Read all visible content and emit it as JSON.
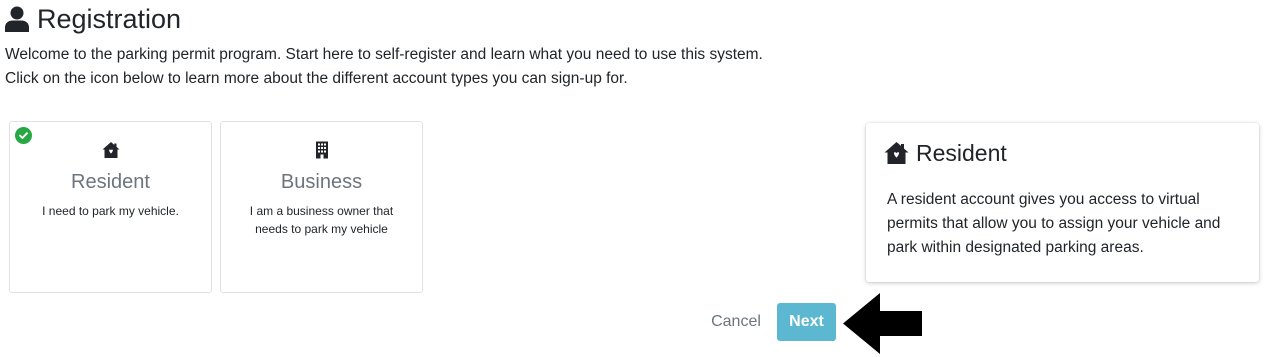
{
  "header": {
    "title": "Registration",
    "icon": "user-icon"
  },
  "intro": {
    "line1": "Welcome to the parking permit program. Start here to self-register and learn what you need to use this system.",
    "line2": "Click on the icon below to learn more about the different account types you can sign-up for."
  },
  "account_types": [
    {
      "title": "Resident",
      "description": "I need to park my vehicle.",
      "icon": "house-icon",
      "selected": true
    },
    {
      "title": "Business",
      "description": "I am a business owner that needs to park my vehicle",
      "icon": "building-icon",
      "selected": false
    }
  ],
  "info_panel": {
    "title": "Resident",
    "icon": "house-icon",
    "body": "A resident account gives you access to virtual permits that allow you to assign your vehicle and park within designated parking areas."
  },
  "actions": {
    "cancel_label": "Cancel",
    "next_label": "Next"
  },
  "colors": {
    "text": "#212529",
    "muted": "#6c757d",
    "selected_check": "#28a745",
    "next_button": "#5bb8d0",
    "card_border": "#dfe2e6"
  }
}
